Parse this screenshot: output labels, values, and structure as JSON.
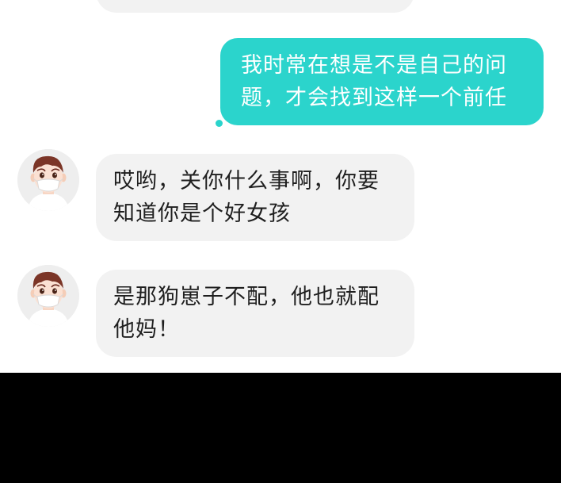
{
  "chat": {
    "messages": [
      {
        "sender": "self",
        "text": "我时常在想是不是自己的问\n题，才会找到这样一个前任"
      },
      {
        "sender": "friend",
        "avatar_icon": "masked-boy-avatar-icon",
        "text": "哎哟，关你什么事啊，你要\n知道你是个好女孩"
      },
      {
        "sender": "friend",
        "avatar_icon": "masked-boy-avatar-icon",
        "text": "是那狗崽子不配，他也就配\n他妈！"
      }
    ]
  },
  "colors": {
    "outgoing_bubble": "#2bd4cc",
    "incoming_bubble": "#f2f2f2",
    "chat_background": "#ffffff",
    "bottom_area": "#000000"
  }
}
